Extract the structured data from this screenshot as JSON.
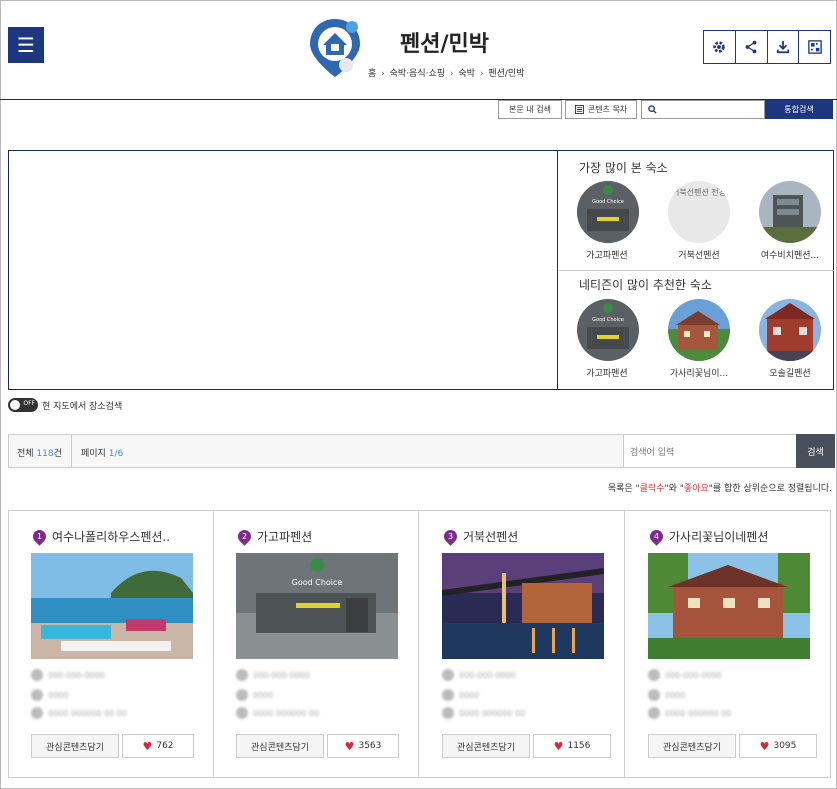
{
  "header": {
    "menu_icon": "hamburger-icon",
    "title": "펜션/민박",
    "breadcrumb": [
      "홈",
      "숙박·음식·쇼핑",
      "숙박",
      "펜션/민박"
    ],
    "tools": [
      "gear-icon",
      "share-icon",
      "download-icon",
      "qr-icon"
    ]
  },
  "searchbar": {
    "in_search_label": "본문 내 검색",
    "contents_label": "콘텐츠 목차",
    "search_placeholder": "",
    "integrated_search_label": "통합검색"
  },
  "side": {
    "most_viewed_title": "가장 많이 본 숙소",
    "most_viewed": [
      {
        "name": "가고파펜션"
      },
      {
        "name": "거북선펜션",
        "placeholder_text": "거북선펜션 전경"
      },
      {
        "name": "여수비치펜션..."
      }
    ],
    "recommended_title": "네티즌이 많이 추천한 숙소",
    "recommended": [
      {
        "name": "가고파펜션"
      },
      {
        "name": "가사리꽃님이..."
      },
      {
        "name": "오솔길펜션"
      }
    ],
    "good_choice_text": "Good Choice"
  },
  "map_toggle": {
    "state": "OFF",
    "label": "현 지도에서 장소검색"
  },
  "list_bar": {
    "total_prefix": "전체",
    "total_count": "118",
    "total_suffix": "건",
    "page_prefix": "페이지",
    "page_value": "1/6",
    "search_placeholder": "검색어 입력",
    "search_label": "검색"
  },
  "sort_note": {
    "p1": "목록은 \"",
    "hl1": "클릭수",
    "p2": "\"와 \"",
    "hl2": "좋아요",
    "p3": "\"를 합한 상위순으로 정렬됩니다."
  },
  "cards": [
    {
      "rank": "1",
      "name": "여수나폴리하우스펜션..",
      "info": [
        "000-000-0000",
        "0000",
        "0000 000000 00 00"
      ],
      "save_label": "관심콘텐츠담기",
      "likes": "762"
    },
    {
      "rank": "2",
      "name": "가고파펜션",
      "info": [
        "000-000-0000",
        "0000",
        "0000 000000 00"
      ],
      "save_label": "관심콘텐츠담기",
      "likes": "3563"
    },
    {
      "rank": "3",
      "name": "거북선펜션",
      "info": [
        "000-000-0000",
        "0000",
        "0000 000000 00"
      ],
      "save_label": "관심콘텐츠담기",
      "likes": "1156"
    },
    {
      "rank": "4",
      "name": "가사리꽃님이네펜션",
      "info": [
        "000-000-0000",
        "0000",
        "0000 000000 00"
      ],
      "save_label": "관심콘텐츠담기",
      "likes": "3095"
    }
  ],
  "colors": {
    "brand": "#1c3680",
    "rank_pin": "#7d2b8c",
    "heart": "#d6283c",
    "count_blue": "#3a8fd8"
  }
}
